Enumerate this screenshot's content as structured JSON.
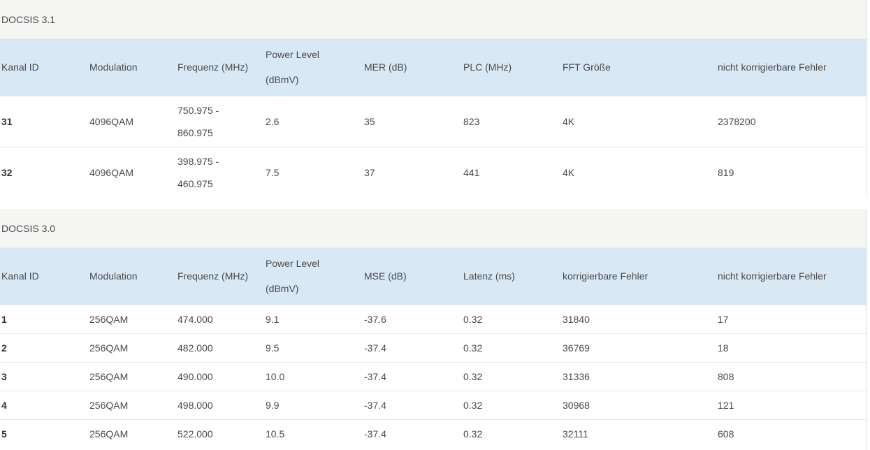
{
  "docsis31": {
    "title": "DOCSIS 3.1",
    "headers": [
      "Kanal ID",
      "Modulation",
      "Frequenz (MHz)",
      "Power Level (dBmV)",
      "MER (dB)",
      "PLC (MHz)",
      "FFT Größe",
      "nicht korrigierbare Fehler"
    ],
    "rows": [
      {
        "id": "31",
        "modulation": "4096QAM",
        "freq_a": "750.975 -",
        "freq_b": "860.975",
        "power": "2.6",
        "mer": "35",
        "plc": "823",
        "fft": "4K",
        "uncorrectable": "2378200"
      },
      {
        "id": "32",
        "modulation": "4096QAM",
        "freq_a": "398.975 -",
        "freq_b": "460.975",
        "power": "7.5",
        "mer": "37",
        "plc": "441",
        "fft": "4K",
        "uncorrectable": "819"
      }
    ]
  },
  "docsis30": {
    "title": "DOCSIS 3.0",
    "headers": [
      "Kanal ID",
      "Modulation",
      "Frequenz (MHz)",
      "Power Level (dBmV)",
      "MSE (dB)",
      "Latenz (ms)",
      "korrigierbare Fehler",
      "nicht korrigierbare Fehler"
    ],
    "rows": [
      {
        "id": "1",
        "modulation": "256QAM",
        "freq": "474.000",
        "power": "9.1",
        "mse": "-37.6",
        "latency": "0.32",
        "correctable": "31840",
        "uncorrectable": "17"
      },
      {
        "id": "2",
        "modulation": "256QAM",
        "freq": "482.000",
        "power": "9.5",
        "mse": "-37.4",
        "latency": "0.32",
        "correctable": "36769",
        "uncorrectable": "18"
      },
      {
        "id": "3",
        "modulation": "256QAM",
        "freq": "490.000",
        "power": "10.0",
        "mse": "-37.4",
        "latency": "0.32",
        "correctable": "31336",
        "uncorrectable": "808"
      },
      {
        "id": "4",
        "modulation": "256QAM",
        "freq": "498.000",
        "power": "9.9",
        "mse": "-37.4",
        "latency": "0.32",
        "correctable": "30968",
        "uncorrectable": "121"
      },
      {
        "id": "5",
        "modulation": "256QAM",
        "freq": "522.000",
        "power": "10.5",
        "mse": "-37.4",
        "latency": "0.32",
        "correctable": "32111",
        "uncorrectable": "608"
      }
    ]
  }
}
